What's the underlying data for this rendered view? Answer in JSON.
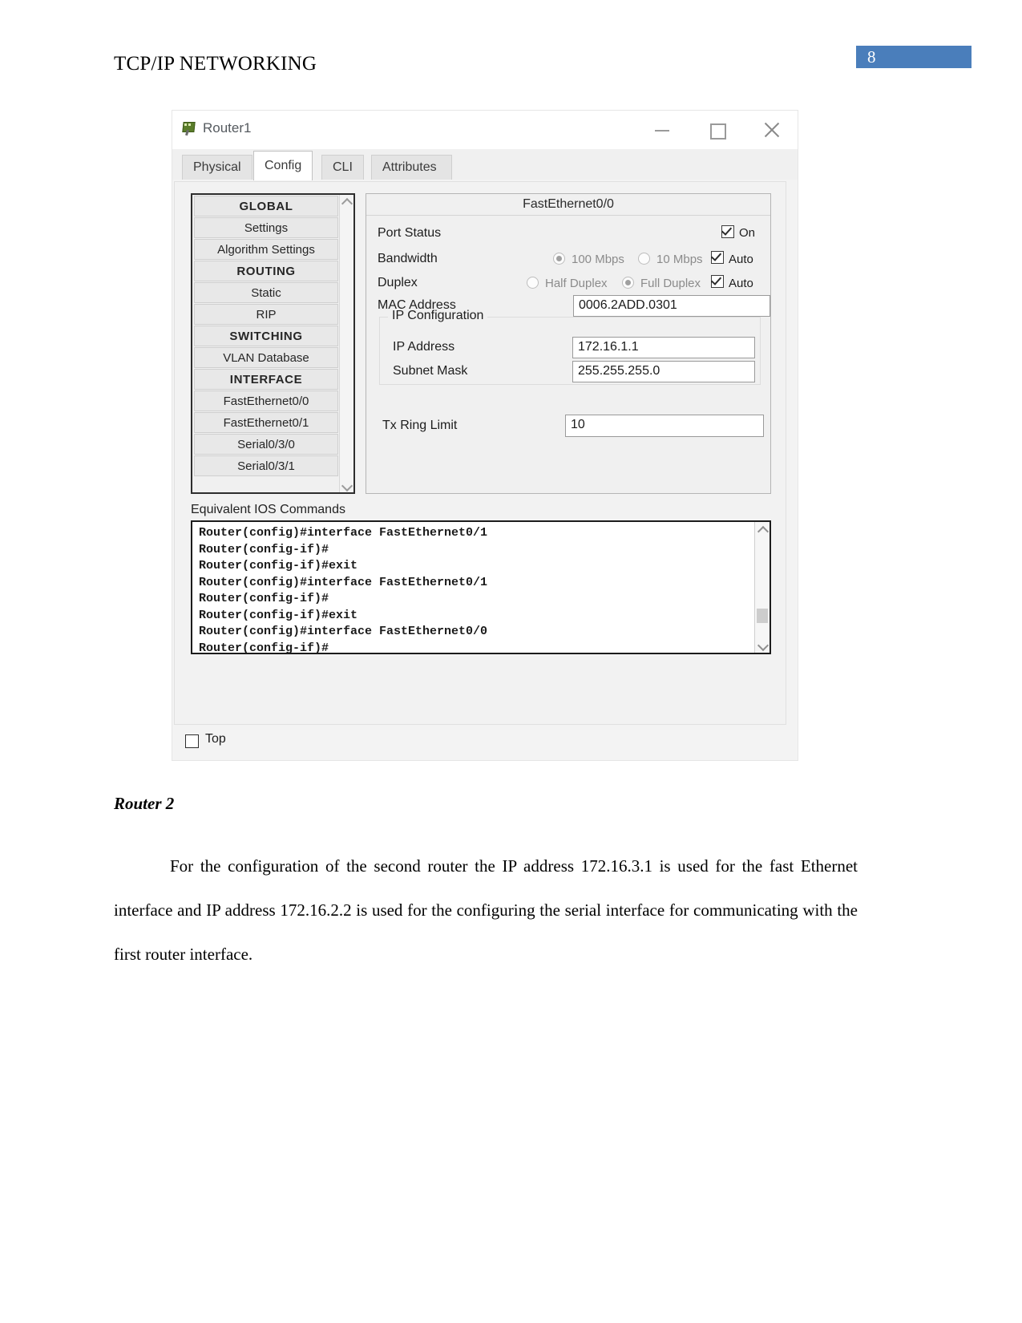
{
  "document": {
    "header_title": "TCP/IP NETWORKING",
    "page_number": "8",
    "badge_color": "#4a7ebb"
  },
  "pt_window": {
    "title": "Router1",
    "window_controls": {
      "minimize": "minimize-icon",
      "maximize": "maximize-icon",
      "close": "close-icon"
    },
    "tabs": [
      {
        "label": "Physical",
        "active": false
      },
      {
        "label": "Config",
        "active": true
      },
      {
        "label": "CLI",
        "active": false
      },
      {
        "label": "Attributes",
        "active": false
      }
    ],
    "nav_items": [
      {
        "label": "GLOBAL",
        "header": true
      },
      {
        "label": "Settings",
        "header": false
      },
      {
        "label": "Algorithm Settings",
        "header": false
      },
      {
        "label": "ROUTING",
        "header": true
      },
      {
        "label": "Static",
        "header": false
      },
      {
        "label": "RIP",
        "header": false
      },
      {
        "label": "SWITCHING",
        "header": true
      },
      {
        "label": "VLAN Database",
        "header": false
      },
      {
        "label": "INTERFACE",
        "header": true
      },
      {
        "label": "FastEthernet0/0",
        "header": false
      },
      {
        "label": "FastEthernet0/1",
        "header": false
      },
      {
        "label": "Serial0/3/0",
        "header": false
      },
      {
        "label": "Serial0/3/1",
        "header": false
      }
    ],
    "interface_panel": {
      "title": "FastEthernet0/0",
      "port_status": {
        "label": "Port Status",
        "on_label": "On",
        "on_checked": true
      },
      "bandwidth": {
        "label": "Bandwidth",
        "option_100": "100 Mbps",
        "option_10": "10 Mbps",
        "selected": "100 Mbps",
        "auto_label": "Auto",
        "auto_checked": true
      },
      "duplex": {
        "label": "Duplex",
        "option_half": "Half Duplex",
        "option_full": "Full Duplex",
        "selected": "Full Duplex",
        "auto_label": "Auto",
        "auto_checked": true
      },
      "mac_address": {
        "label": "MAC Address",
        "value": "0006.2ADD.0301"
      },
      "ip_configuration": {
        "legend": "IP Configuration",
        "ip_address_label": "IP Address",
        "ip_address_value": "172.16.1.1",
        "subnet_mask_label": "Subnet Mask",
        "subnet_mask_value": "255.255.255.0"
      },
      "tx_ring_limit": {
        "label": "Tx Ring Limit",
        "value": "10"
      }
    },
    "ios_commands": {
      "label": "Equivalent IOS Commands",
      "lines": [
        "Router(config)#interface FastEthernet0/1",
        "Router(config-if)#",
        "Router(config-if)#exit",
        "Router(config)#interface FastEthernet0/1",
        "Router(config-if)#",
        "Router(config-if)#exit",
        "Router(config)#interface FastEthernet0/0",
        "Router(config-if)#"
      ]
    },
    "footer": {
      "top_label": "Top",
      "top_checked": false
    }
  },
  "prose": {
    "router2_heading": "Router 2",
    "paragraph": "For the configuration of the second router the IP address 172.16.3.1 is used for the fast Ethernet interface and IP address 172.16.2.2 is used for the configuring the serial interface for communicating with the first router interface."
  }
}
